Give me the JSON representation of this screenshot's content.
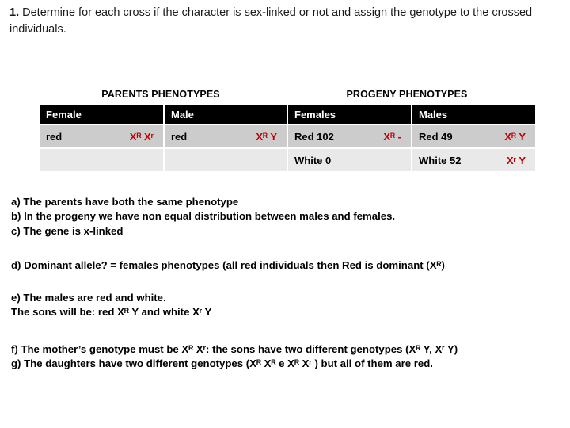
{
  "prompt": {
    "number": "1.",
    "text": "Determine for each cross if the character is sex-linked or not and assign the genotype to the crossed individuals."
  },
  "table": {
    "group_titles": {
      "parents": "PARENTS PHENOTYPES",
      "progeny": "PROGENY PHENOTYPES"
    },
    "headers": [
      "Female",
      "Male",
      "Females",
      "Males"
    ],
    "rows": [
      {
        "female_pheno": "red",
        "female_geno": "Xᴿ Xʳ",
        "male_pheno": "red",
        "male_geno": "Xᴿ Y",
        "progeny_female_pheno": "Red 102",
        "progeny_female_geno": "Xᴿ -",
        "progeny_male_pheno": "Red 49",
        "progeny_male_geno": "Xᴿ Y"
      },
      {
        "female_pheno": "",
        "female_geno": "",
        "male_pheno": "",
        "male_geno": "",
        "progeny_female_pheno": "White 0",
        "progeny_female_geno": "",
        "progeny_male_pheno": "White 52",
        "progeny_male_geno": "Xʳ Y"
      }
    ]
  },
  "answers": {
    "a": "a) The parents have both the same phenotype",
    "b": "b) In the progeny we have non equal distribution between males and females.",
    "c": "c) The gene is x-linked",
    "d": "d) Dominant allele? = females phenotypes (all red individuals then Red is dominant (Xᴿ)",
    "e1": "e) The males are red and white.",
    "e2": "The sons will be: red  Xᴿ Y  and white Xʳ Y",
    "f": "f) The mother’s genotype must be Xᴿ Xʳ: the sons have two different genotypes (Xᴿ Y, Xʳ Y)",
    "g": "g) The daughters have two different genotypes (Xᴿ Xᴿ e Xᴿ Xʳ ) but all of them are red."
  },
  "colors": {
    "genotype_red": "#C00000",
    "header_bg": "#000000",
    "row_a_bg": "#CCCCCC",
    "row_b_bg": "#E9E9E9"
  }
}
